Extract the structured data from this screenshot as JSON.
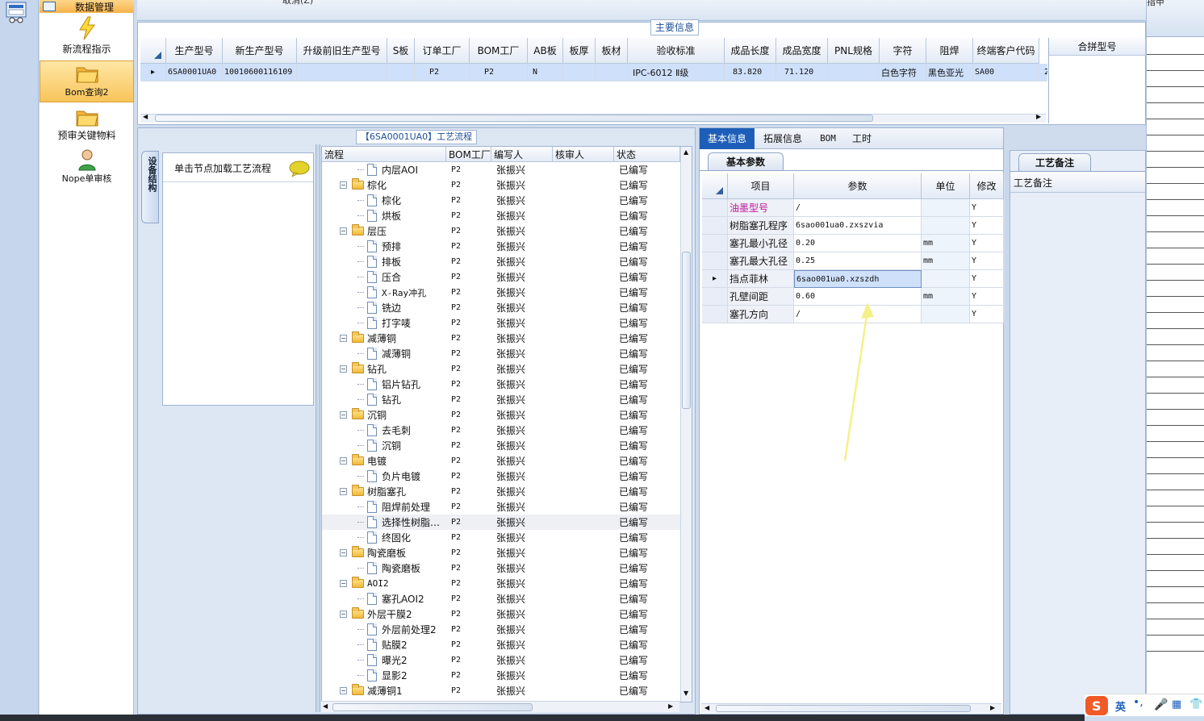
{
  "sidebar": {
    "top_label": "数据管理",
    "items": [
      {
        "label": "新流程指示",
        "icon": "lightning-icon"
      },
      {
        "label": "Bom查询2",
        "icon": "folder-icon"
      },
      {
        "label": "预审关键物料",
        "icon": "folder-icon"
      },
      {
        "label": "Nope单审核",
        "icon": "user-icon"
      }
    ]
  },
  "top_partial_text": "取消(Z)",
  "main_info": {
    "title": "主要信息",
    "columns": [
      "生产型号",
      "新生产型号",
      "升级前旧生产型号",
      "S板",
      "订单工厂",
      "BOM工厂",
      "AB板",
      "板厚",
      "板材",
      "验收标准",
      "成品长度",
      "成品宽度",
      "PNL规格",
      "字符",
      "阻焊",
      "终端客户代码"
    ],
    "row": [
      "6SA0001UA0",
      "10010600116109",
      "",
      "",
      "P2",
      "P2",
      "N",
      "",
      "",
      "IPC-6012 Ⅱ级",
      "83.820",
      "71.120",
      "",
      "白色字符",
      "黑色亚光",
      "SA00"
    ],
    "row_tail": "2",
    "merge_column": "合拼型号"
  },
  "process_panel": {
    "title": "【6SA0001UA0】工艺流程",
    "side_tab": "设备结构",
    "hint": "单击节点加载工艺流程",
    "tree_columns": [
      "流程",
      "BOM工厂",
      "编写人",
      "核审人",
      "状态"
    ],
    "rows": [
      {
        "name": "内层AOI",
        "level": 2,
        "factory": "P2",
        "writer": "张振兴",
        "reviewer": "",
        "status": "已编写"
      },
      {
        "name": "棕化",
        "level": 1,
        "factory": "P2",
        "writer": "张振兴",
        "reviewer": "",
        "status": "已编写"
      },
      {
        "name": "棕化",
        "level": 2,
        "factory": "P2",
        "writer": "张振兴",
        "reviewer": "",
        "status": "已编写"
      },
      {
        "name": "烘板",
        "level": 2,
        "factory": "P2",
        "writer": "张振兴",
        "reviewer": "",
        "status": "已编写"
      },
      {
        "name": "层压",
        "level": 1,
        "factory": "P2",
        "writer": "张振兴",
        "reviewer": "",
        "status": "已编写"
      },
      {
        "name": "预排",
        "level": 2,
        "factory": "P2",
        "writer": "张振兴",
        "reviewer": "",
        "status": "已编写"
      },
      {
        "name": "排板",
        "level": 2,
        "factory": "P2",
        "writer": "张振兴",
        "reviewer": "",
        "status": "已编写"
      },
      {
        "name": "压合",
        "level": 2,
        "factory": "P2",
        "writer": "张振兴",
        "reviewer": "",
        "status": "已编写"
      },
      {
        "name": "X-Ray冲孔",
        "level": 2,
        "factory": "P2",
        "writer": "张振兴",
        "reviewer": "",
        "status": "已编写"
      },
      {
        "name": "铣边",
        "level": 2,
        "factory": "P2",
        "writer": "张振兴",
        "reviewer": "",
        "status": "已编写"
      },
      {
        "name": "打字唛",
        "level": 2,
        "factory": "P2",
        "writer": "张振兴",
        "reviewer": "",
        "status": "已编写"
      },
      {
        "name": "减薄铜",
        "level": 1,
        "factory": "P2",
        "writer": "张振兴",
        "reviewer": "",
        "status": "已编写"
      },
      {
        "name": "减薄铜",
        "level": 2,
        "factory": "P2",
        "writer": "张振兴",
        "reviewer": "",
        "status": "已编写"
      },
      {
        "name": "钻孔",
        "level": 1,
        "factory": "P2",
        "writer": "张振兴",
        "reviewer": "",
        "status": "已编写"
      },
      {
        "name": "铝片钻孔",
        "level": 2,
        "factory": "P2",
        "writer": "张振兴",
        "reviewer": "",
        "status": "已编写"
      },
      {
        "name": "钻孔",
        "level": 2,
        "factory": "P2",
        "writer": "张振兴",
        "reviewer": "",
        "status": "已编写"
      },
      {
        "name": "沉铜",
        "level": 1,
        "factory": "P2",
        "writer": "张振兴",
        "reviewer": "",
        "status": "已编写"
      },
      {
        "name": "去毛刺",
        "level": 2,
        "factory": "P2",
        "writer": "张振兴",
        "reviewer": "",
        "status": "已编写"
      },
      {
        "name": "沉铜",
        "level": 2,
        "factory": "P2",
        "writer": "张振兴",
        "reviewer": "",
        "status": "已编写"
      },
      {
        "name": "电镀",
        "level": 1,
        "factory": "P2",
        "writer": "张振兴",
        "reviewer": "",
        "status": "已编写"
      },
      {
        "name": "负片电镀",
        "level": 2,
        "factory": "P2",
        "writer": "张振兴",
        "reviewer": "",
        "status": "已编写"
      },
      {
        "name": "树脂塞孔",
        "level": 1,
        "factory": "P2",
        "writer": "张振兴",
        "reviewer": "",
        "status": "已编写"
      },
      {
        "name": "阻焊前处理",
        "level": 2,
        "factory": "P2",
        "writer": "张振兴",
        "reviewer": "",
        "status": "已编写"
      },
      {
        "name": "选择性树脂…",
        "level": 2,
        "factory": "P2",
        "writer": "张振兴",
        "reviewer": "",
        "status": "已编写",
        "selected": true
      },
      {
        "name": "终固化",
        "level": 2,
        "factory": "P2",
        "writer": "张振兴",
        "reviewer": "",
        "status": "已编写"
      },
      {
        "name": "陶瓷磨板",
        "level": 1,
        "factory": "P2",
        "writer": "张振兴",
        "reviewer": "",
        "status": "已编写"
      },
      {
        "name": "陶瓷磨板",
        "level": 2,
        "factory": "P2",
        "writer": "张振兴",
        "reviewer": "",
        "status": "已编写"
      },
      {
        "name": "AOI2",
        "level": 1,
        "factory": "P2",
        "writer": "张振兴",
        "reviewer": "",
        "status": "已编写"
      },
      {
        "name": "塞孔AOI2",
        "level": 2,
        "factory": "P2",
        "writer": "张振兴",
        "reviewer": "",
        "status": "已编写"
      },
      {
        "name": "外层干膜2",
        "level": 1,
        "factory": "P2",
        "writer": "张振兴",
        "reviewer": "",
        "status": "已编写"
      },
      {
        "name": "外层前处理2",
        "level": 2,
        "factory": "P2",
        "writer": "张振兴",
        "reviewer": "",
        "status": "已编写"
      },
      {
        "name": "贴膜2",
        "level": 2,
        "factory": "P2",
        "writer": "张振兴",
        "reviewer": "",
        "status": "已编写"
      },
      {
        "name": "曝光2",
        "level": 2,
        "factory": "P2",
        "writer": "张振兴",
        "reviewer": "",
        "status": "已编写"
      },
      {
        "name": "显影2",
        "level": 2,
        "factory": "P2",
        "writer": "张振兴",
        "reviewer": "",
        "status": "已编写"
      },
      {
        "name": "减薄铜1",
        "level": 1,
        "factory": "P2",
        "writer": "张振兴",
        "reviewer": "",
        "status": "已编写"
      }
    ]
  },
  "detail_panel": {
    "tabs": [
      "基本信息",
      "拓展信息",
      "BOM",
      "工时"
    ],
    "subtab": "基本参数",
    "param_columns": [
      "项目",
      "参数",
      "单位",
      "修改"
    ],
    "params": [
      {
        "item": "油墨型号",
        "value": "/",
        "unit": "",
        "modify": "Y",
        "highlight": true
      },
      {
        "item": "树脂塞孔程序",
        "value": "6sao001ua0.zxszvia",
        "unit": "",
        "modify": "Y"
      },
      {
        "item": "塞孔最小孔径",
        "value": "0.20",
        "unit": "mm",
        "modify": "Y"
      },
      {
        "item": "塞孔最大孔径",
        "value": "0.25",
        "unit": "mm",
        "modify": "Y"
      },
      {
        "item": "挡点菲林",
        "value": "6sao001ua0.xzszdh",
        "unit": "",
        "modify": "Y",
        "selected": true
      },
      {
        "item": "孔壁间距",
        "value": "0.60",
        "unit": "mm",
        "modify": "Y"
      },
      {
        "item": "塞孔方向",
        "value": "/",
        "unit": "",
        "modify": "Y"
      }
    ]
  },
  "remark_panel": {
    "tab": "工艺备注",
    "label": "工艺备注"
  },
  "top_right_partial": "指甲",
  "ime_bar": {
    "lang": "英"
  },
  "colors": {
    "accent": "#1d5fb8",
    "selected_row": "#cfe0fa",
    "highlight_text": "#c0139c",
    "arrow": "#f6f08a"
  }
}
